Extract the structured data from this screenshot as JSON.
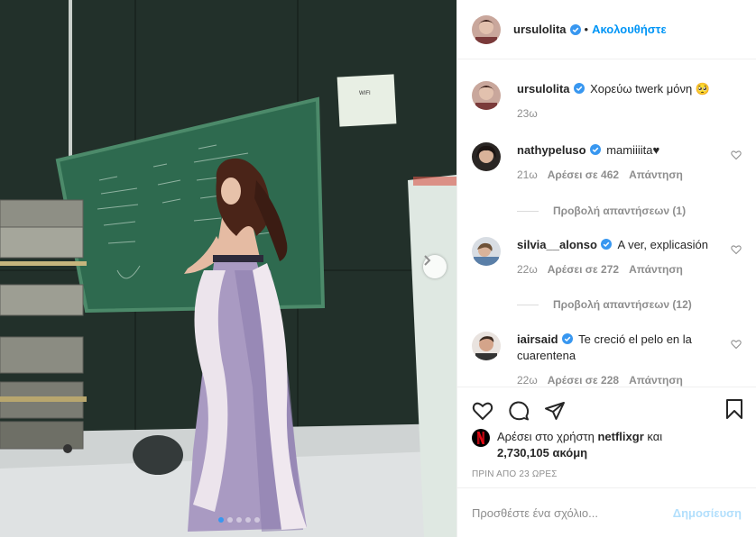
{
  "post": {
    "author": "ursulolita",
    "follow_sep": "•",
    "follow_label": "Ακολουθήστε",
    "caption": "Χορεύω twerk μόνη 🥺",
    "caption_time": "23ω",
    "carousel": {
      "slides": 5,
      "active_index": 0
    }
  },
  "comments": [
    {
      "user": "nathypeluso",
      "text": "mamiiiita♥",
      "time": "21ω",
      "likes": "Αρέσει σε 462",
      "reply_label": "Απάντηση",
      "view_replies": "Προβολή απαντήσεων (1)"
    },
    {
      "user": "silvia__alonso",
      "text": "A ver, explicasión",
      "time": "22ω",
      "likes": "Αρέσει σε 272",
      "reply_label": "Απάντηση",
      "view_replies": "Προβολή απαντήσεων (12)"
    },
    {
      "user": "iairsaid",
      "text": "Te creció el pelo en la cuarentena",
      "time": "22ω",
      "likes": "Αρέσει σε 228",
      "reply_label": "Απάντηση"
    }
  ],
  "likes": {
    "prefix": "Αρέσει στο χρήστη",
    "user": "netflixgr",
    "middle": "και",
    "count": "2,730,105",
    "suffix": "ακόμη"
  },
  "timestamp": "ΠΡΙΝ ΑΠΟ 23 ΩΡΕΣ",
  "add_comment": {
    "placeholder": "Προσθέστε ένα σχόλιο...",
    "post_label": "Δημοσίευση"
  },
  "colors": {
    "accent": "#0095f6",
    "verified": "#3897f0",
    "netflix": "#e50914",
    "muted": "#8e8e8e"
  }
}
